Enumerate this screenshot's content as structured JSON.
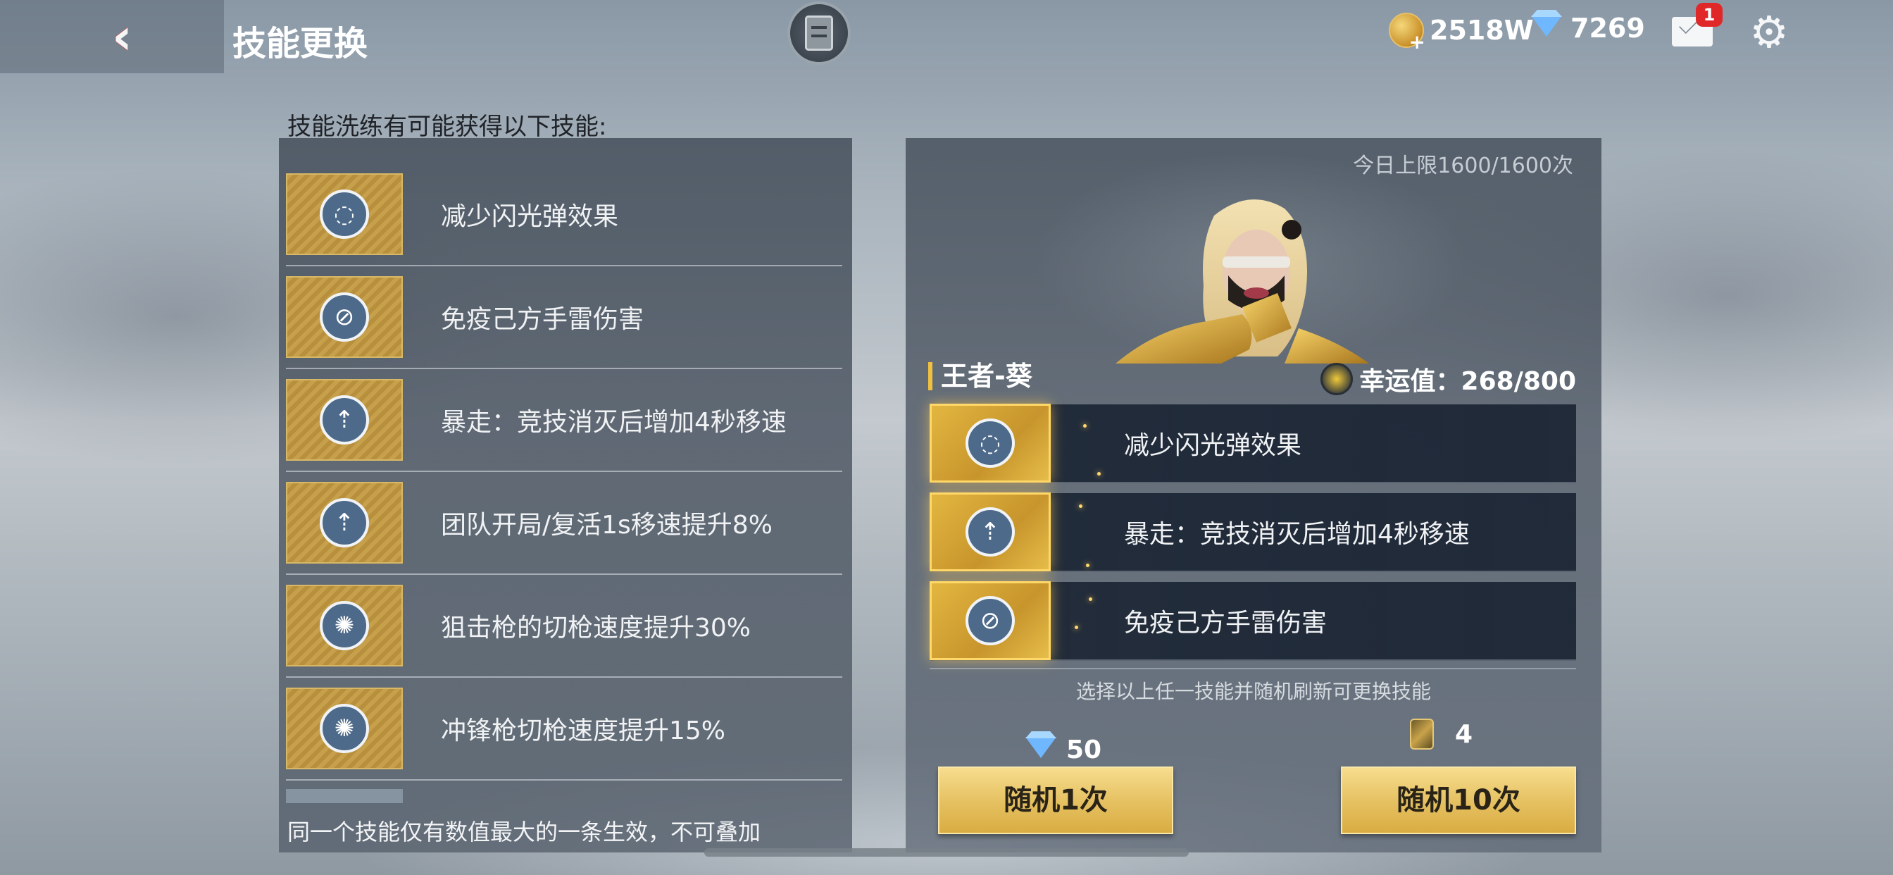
{
  "header": {
    "title": "技能更换",
    "gold_amount": "2518W",
    "diamond_amount": "7269",
    "mail_badge_count": "1"
  },
  "left_panel": {
    "heading": "技能洗练有可能获得以下技能:",
    "skills": [
      {
        "label": "减少闪光弹效果",
        "icon": "goggles-icon"
      },
      {
        "label": "免疫己方手雷伤害",
        "icon": "grenade-immune-icon"
      },
      {
        "label": "暴走：竞技消灭后增加4秒移速",
        "icon": "boot-speed-icon"
      },
      {
        "label": "团队开局/复活1s移速提升8%",
        "icon": "boot-speed-icon"
      },
      {
        "label": "狙击枪的切枪速度提升30%",
        "icon": "dragon-icon"
      },
      {
        "label": "冲锋枪切枪速度提升15%",
        "icon": "dragon-icon"
      }
    ],
    "footnote": "同一个技能仅有数值最大的一条生效，不可叠加"
  },
  "right_panel": {
    "daily_limit": "今日上限1600/1600次",
    "character_name": "王者-葵",
    "luck_label": "幸运值：268/800",
    "current_skills": [
      {
        "label": "减少闪光弹效果",
        "icon": "goggles-icon"
      },
      {
        "label": "暴走：竞技消灭后增加4秒移速",
        "icon": "boot-speed-icon"
      },
      {
        "label": "免疫己方手雷伤害",
        "icon": "grenade-immune-icon"
      }
    ],
    "hint": "选择以上任一技能并随机刷新可更换技能",
    "random_once": {
      "label": "随机1次",
      "cost": "50"
    },
    "random_ten": {
      "label": "随机10次",
      "cost": "4"
    }
  },
  "colors": {
    "gold_button": "#e6c263",
    "panel": "#48525e",
    "accent_yellow": "#f0c040",
    "badge_red": "#e02828"
  }
}
